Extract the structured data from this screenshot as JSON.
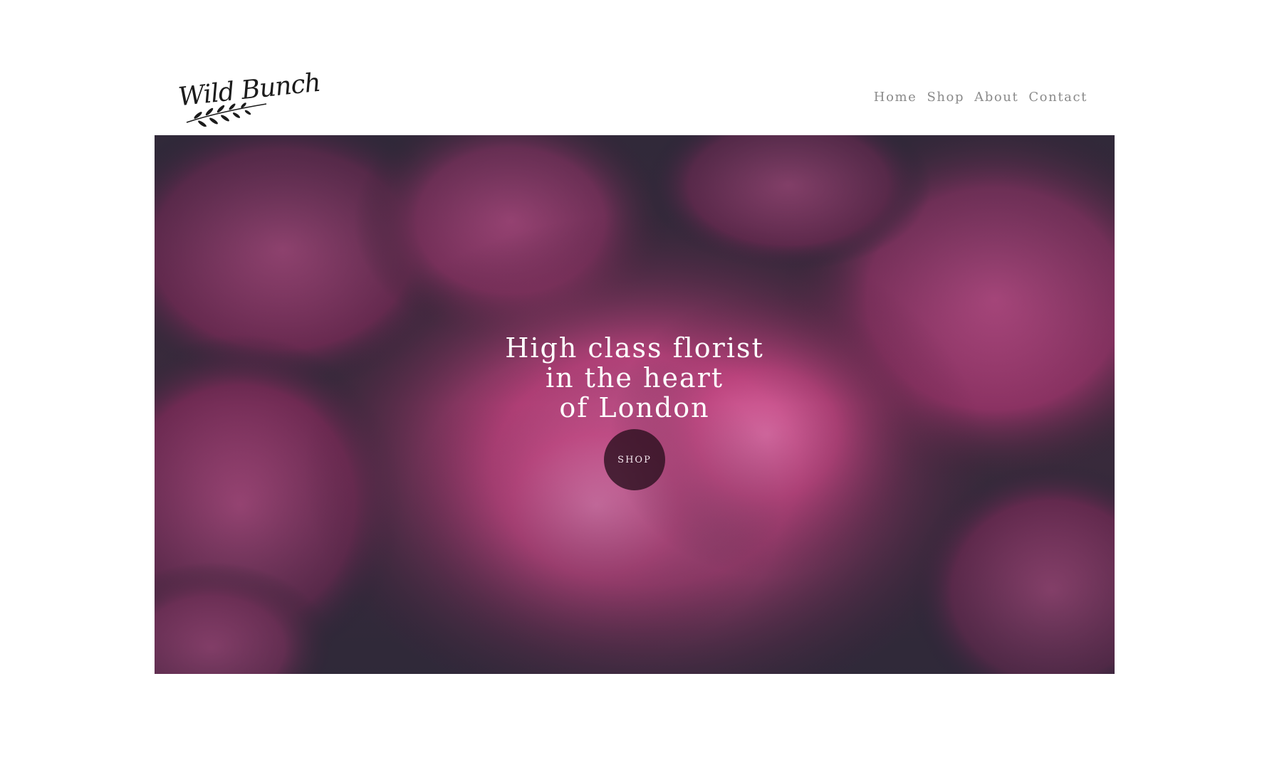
{
  "brand": {
    "logo_text": "Wild Bunch"
  },
  "nav": {
    "items": [
      {
        "label": "Home"
      },
      {
        "label": "Shop"
      },
      {
        "label": "About"
      },
      {
        "label": "Contact"
      }
    ]
  },
  "hero": {
    "headline_lines": [
      "High class florist",
      "in the heart",
      "of London"
    ],
    "cta_label": "SHOP"
  },
  "colors": {
    "accent": "#3b2436",
    "flower_pink": "#c0447f",
    "nav_text": "#8a8a8a"
  }
}
